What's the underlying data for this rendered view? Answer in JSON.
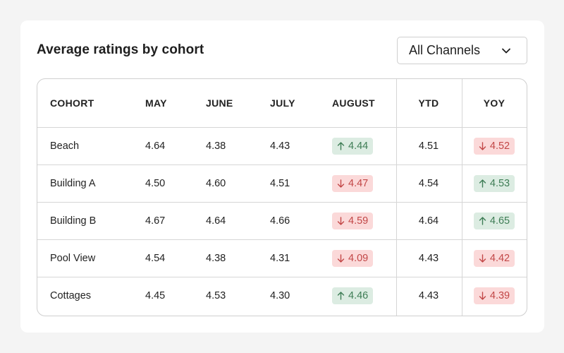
{
  "card": {
    "title": "Average ratings by cohort",
    "filter": {
      "selected": "All Channels"
    }
  },
  "table": {
    "headers": {
      "cohort": "COHORT",
      "may": "MAY",
      "june": "JUNE",
      "july": "JULY",
      "august": "AUGUST",
      "ytd": "YTD",
      "yoy": "YOY"
    },
    "rows": [
      {
        "cohort": "Beach",
        "may": "4.64",
        "june": "4.38",
        "july": "4.43",
        "august": "4.44",
        "august_trend": "up",
        "ytd": "4.51",
        "yoy": "4.52",
        "yoy_trend": "down"
      },
      {
        "cohort": "Building A",
        "may": "4.50",
        "june": "4.60",
        "july": "4.51",
        "august": "4.47",
        "august_trend": "down",
        "ytd": "4.54",
        "yoy": "4.53",
        "yoy_trend": "up"
      },
      {
        "cohort": "Building B",
        "may": "4.67",
        "june": "4.64",
        "july": "4.66",
        "august": "4.59",
        "august_trend": "down",
        "ytd": "4.64",
        "yoy": "4.65",
        "yoy_trend": "up"
      },
      {
        "cohort": "Pool View",
        "may": "4.54",
        "june": "4.38",
        "july": "4.31",
        "august": "4.09",
        "august_trend": "down",
        "ytd": "4.43",
        "yoy": "4.42",
        "yoy_trend": "down"
      },
      {
        "cohort": "Cottages",
        "may": "4.45",
        "june": "4.53",
        "july": "4.30",
        "august": "4.46",
        "august_trend": "up",
        "ytd": "4.43",
        "yoy": "4.39",
        "yoy_trend": "down"
      }
    ]
  },
  "colors": {
    "up_bg": "#dcece2",
    "up_fg": "#3e7d55",
    "down_bg": "#fbd9d9",
    "down_fg": "#c24747"
  },
  "icons": {
    "up": "arrow-up-icon",
    "down": "arrow-down-icon",
    "dropdown": "chevron-down-icon"
  }
}
